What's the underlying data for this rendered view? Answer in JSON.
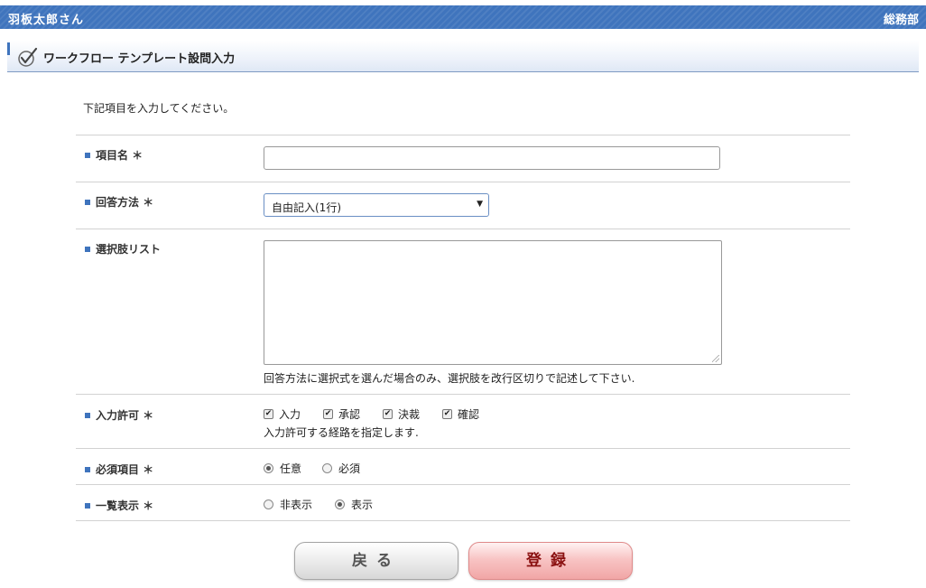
{
  "header": {
    "user": "羽板太郎さん",
    "department": "総務部"
  },
  "page": {
    "title": "ワークフロー テンプレート設問入力",
    "title_icon": "check-icon"
  },
  "intro": "下記項目を入力してください。",
  "form": {
    "item_name": {
      "label": "項目名 ＊",
      "value": ""
    },
    "answer_method": {
      "label": "回答方法 ＊",
      "selected": "自由記入(1行)"
    },
    "choices": {
      "label": "選択肢リスト",
      "value": "",
      "hint": "回答方法に選択式を選んだ場合のみ、選択肢を改行区切りで記述して下さい."
    },
    "input_permission": {
      "label": "入力許可 ＊",
      "options": [
        {
          "label": "入力",
          "checked": true
        },
        {
          "label": "承認",
          "checked": true
        },
        {
          "label": "決裁",
          "checked": true
        },
        {
          "label": "確認",
          "checked": true
        }
      ],
      "hint": "入力許可する経路を指定します."
    },
    "required": {
      "label": "必須項目 ＊",
      "options": [
        {
          "label": "任意",
          "selected": true
        },
        {
          "label": "必須",
          "selected": false
        }
      ]
    },
    "list_display": {
      "label": "一覧表示 ＊",
      "options": [
        {
          "label": "非表示",
          "selected": false
        },
        {
          "label": "表示",
          "selected": true
        }
      ]
    }
  },
  "buttons": {
    "back": "戻る",
    "save": "登録"
  },
  "colors": {
    "header_blue": "#3f74bd",
    "save_text": "#8a1010",
    "save_bg": "#f8c4c4"
  }
}
